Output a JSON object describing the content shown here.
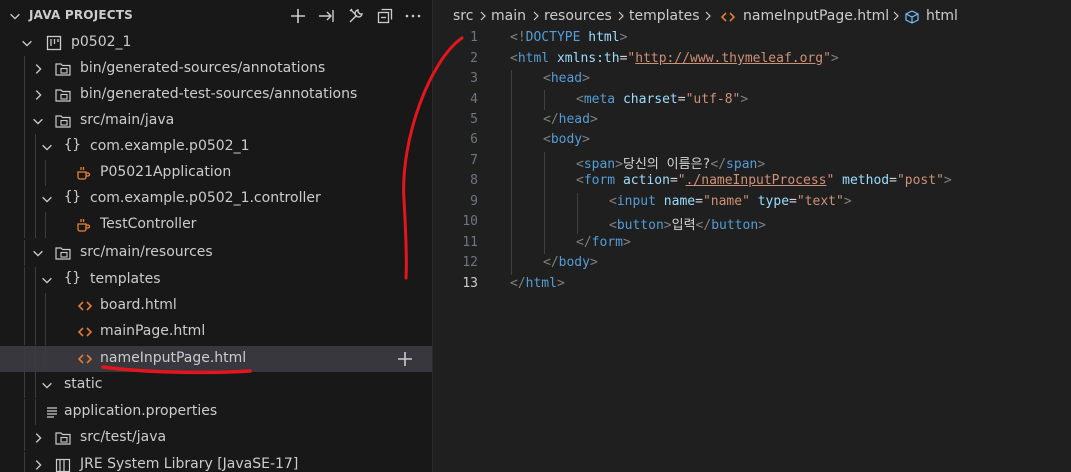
{
  "sidebar": {
    "title": "JAVA PROJECTS",
    "header_icons": [
      "add-icon",
      "export-jar-icon",
      "configure-icon",
      "collapse-all-icon"
    ],
    "tree": [
      {
        "label": "p0502_1",
        "icon": "project-icon",
        "expanded": true
      },
      {
        "label": "bin/generated-sources/annotations",
        "icon": "package-folder-icon",
        "expanded": false
      },
      {
        "label": "bin/generated-test-sources/annotations",
        "icon": "package-folder-icon",
        "expanded": false
      },
      {
        "label": "src/main/java",
        "icon": "package-folder-icon",
        "expanded": true
      },
      {
        "label": "com.example.p0502_1",
        "icon": "package-icon",
        "expanded": true
      },
      {
        "label": "P05021Application",
        "icon": "java-class-icon"
      },
      {
        "label": "com.example.p0502_1.controller",
        "icon": "package-icon",
        "expanded": true
      },
      {
        "label": "TestController",
        "icon": "java-class-icon"
      },
      {
        "label": "src/main/resources",
        "icon": "package-folder-icon",
        "expanded": true
      },
      {
        "label": "templates",
        "icon": "package-icon",
        "expanded": true
      },
      {
        "label": "board.html",
        "icon": "html-file-icon"
      },
      {
        "label": "mainPage.html",
        "icon": "html-file-icon"
      },
      {
        "label": "nameInputPage.html",
        "icon": "html-file-icon",
        "selected": true
      },
      {
        "label": "static",
        "expanded": true
      },
      {
        "label": "application.properties",
        "icon": "properties-file-icon"
      },
      {
        "label": "src/test/java",
        "icon": "package-folder-icon",
        "expanded": false
      },
      {
        "label": "JRE System Library [JavaSE-17]",
        "icon": "library-icon",
        "expanded": false
      }
    ]
  },
  "editor": {
    "breadcrumb": [
      "src",
      "main",
      "resources",
      "templates",
      "nameInputPage.html",
      "html"
    ],
    "active_line": 13,
    "line_numbers": [
      "1",
      "2",
      "3",
      "4",
      "5",
      "6",
      "7",
      "8",
      "9",
      "10",
      "11",
      "12",
      "13"
    ],
    "code": {
      "l1_open": "<!",
      "l1_kw": "DOCTYPE",
      "l1_name": " html",
      "l1_close": ">",
      "l2_tag": "html",
      "l2_attr": "xmlns:th",
      "l2_url": "http://www.thymeleaf.org",
      "l3_tag": "head",
      "l4_tag": "meta",
      "l4_attr": "charset",
      "l4_val": "\"utf-8\"",
      "l5_tag": "head",
      "l6_tag": "body",
      "l7_tag": "span",
      "l7_text": "당신의 이름은?",
      "l8_tag": "form",
      "l8_attr1": "action",
      "l8_val1": "./nameInputProcess",
      "l8_attr2": "method",
      "l8_val2": "\"post\"",
      "l9_tag": "input",
      "l9_attr1": "name",
      "l9_val1": "\"name\"",
      "l9_attr2": "type",
      "l9_val2": "\"text\"",
      "l10_tag": "button",
      "l10_text": "입력",
      "l11_tag": "form",
      "l12_tag": "body",
      "l13_tag": "html"
    }
  },
  "colors": {
    "annotation": "#e3161d",
    "selection": "#37373d",
    "java_class": "#e8833a",
    "html_icon": "#e37933"
  }
}
